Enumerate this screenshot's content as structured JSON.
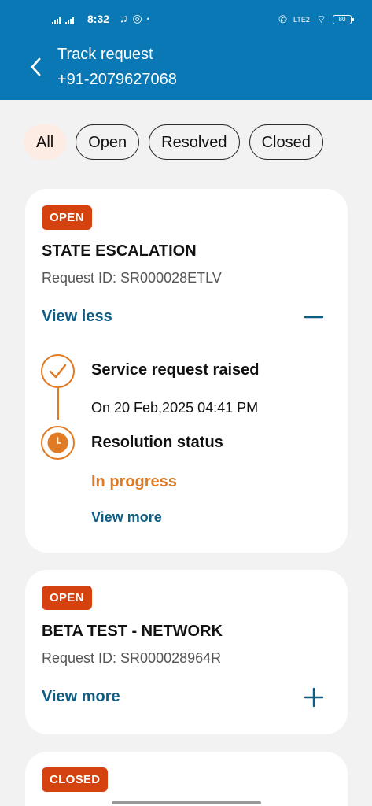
{
  "status_bar": {
    "time": "8:32",
    "network": "LTE2",
    "battery": "80"
  },
  "header": {
    "title": "Track request",
    "subtitle": "+91-2079627068"
  },
  "filters": [
    {
      "label": "All",
      "active": true
    },
    {
      "label": "Open",
      "active": false
    },
    {
      "label": "Resolved",
      "active": false
    },
    {
      "label": "Closed",
      "active": false
    }
  ],
  "requests": [
    {
      "badge": "OPEN",
      "title": "STATE ESCALATION",
      "request_id": "Request ID: SR000028ETLV",
      "toggle_label": "View less",
      "expanded": true,
      "timeline": {
        "raised_title": "Service request raised",
        "raised_date": "On 20 Feb,2025 04:41 PM",
        "status_title": "Resolution status",
        "status_value": "In progress",
        "view_more": "View more"
      }
    },
    {
      "badge": "OPEN",
      "title": "BETA TEST - NETWORK",
      "request_id": "Request ID: SR000028964R",
      "toggle_label": "View more",
      "expanded": false
    },
    {
      "badge": "CLOSED"
    }
  ],
  "colors": {
    "header_bg": "#0a78b5",
    "badge_bg": "#d3420f",
    "accent_orange": "#e07b24",
    "link_blue": "#0f5d84",
    "chip_active_bg": "#fcece4"
  }
}
